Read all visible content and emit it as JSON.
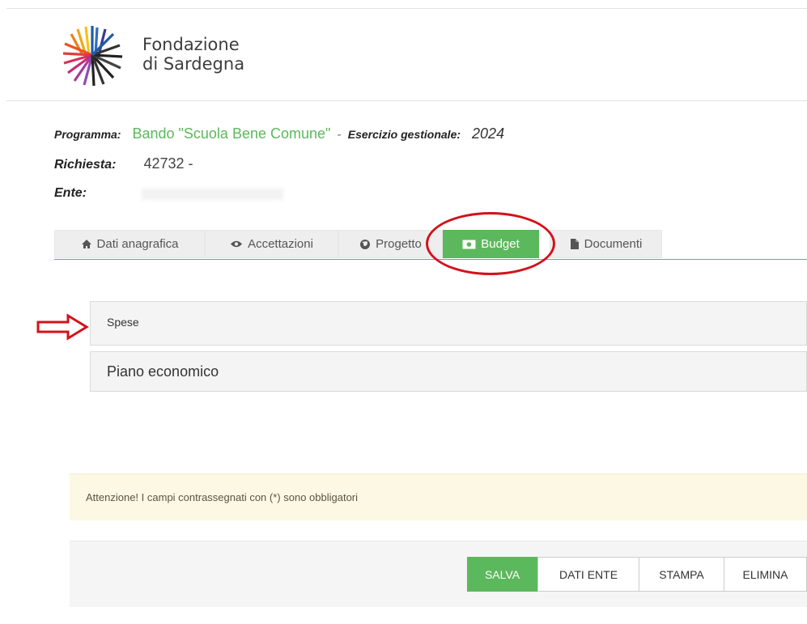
{
  "brand": {
    "line1": "Fondazione",
    "line2": "di Sardegna"
  },
  "info": {
    "programma_label": "Programma:",
    "programma_value": "Bando \"Scuola Bene Comune\"",
    "separator": "-",
    "esercizio_label": "Esercizio gestionale:",
    "esercizio_value": "2024",
    "richiesta_label": "Richiesta:",
    "richiesta_value": "42732 -",
    "ente_label": "Ente:"
  },
  "tabs": [
    {
      "label": "Dati anagrafica",
      "icon": "home-icon"
    },
    {
      "label": "Accettazioni",
      "icon": "eye-icon"
    },
    {
      "label": "Progetto",
      "icon": "globe-icon"
    },
    {
      "label": "Budget",
      "icon": "money-icon",
      "active": true
    },
    {
      "label": "Documenti",
      "icon": "file-icon"
    }
  ],
  "panels": {
    "spese": "Spese",
    "piano": "Piano economico"
  },
  "alert": "Attenzione! I campi contrassegnati con (*) sono obbligatori",
  "buttons": {
    "save": "SALVA",
    "dati_ente": "DATI ENTE",
    "print": "STAMPA",
    "delete": "ELIMINA"
  },
  "colors": {
    "accent": "#5cb85c",
    "annotation": "#d3121b",
    "alert_bg": "#fcf8e3"
  }
}
